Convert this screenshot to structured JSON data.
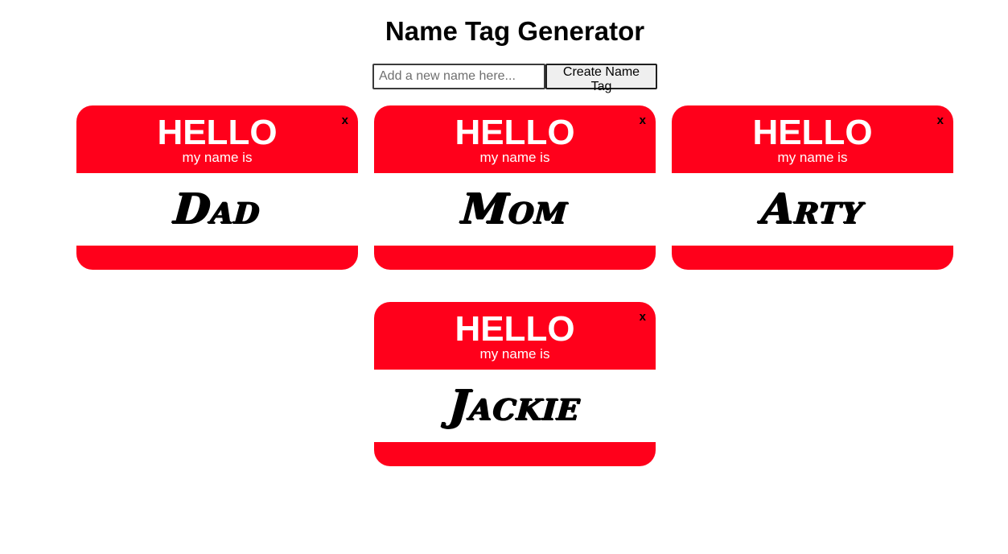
{
  "page": {
    "title": "Name Tag Generator"
  },
  "form": {
    "input_placeholder": "Add a new name here...",
    "input_value": "",
    "button_label": "Create Name Tag"
  },
  "tag_labels": {
    "hello": "HELLO",
    "subtitle": "my name is",
    "close": "x"
  },
  "tags": [
    {
      "name": "Dad"
    },
    {
      "name": "Mom"
    },
    {
      "name": "Arty"
    },
    {
      "name": "Jackie"
    }
  ],
  "colors": {
    "tag_red": "#ff001b",
    "tag_white": "#ffffff",
    "text_black": "#000000"
  }
}
